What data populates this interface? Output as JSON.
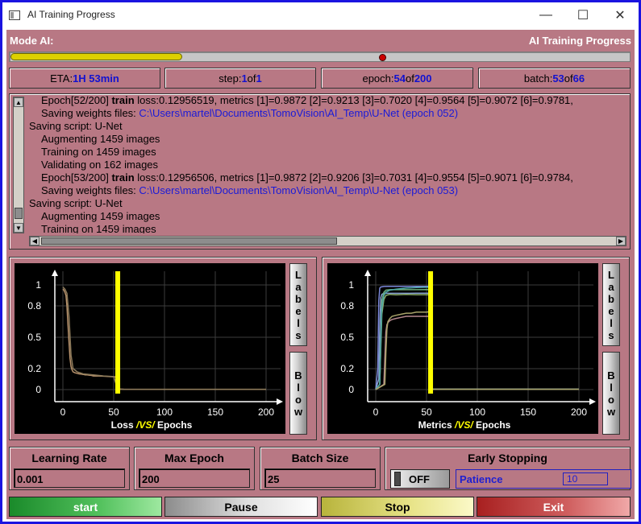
{
  "window": {
    "title": "AI Training Progress",
    "minimize": "—",
    "maximize": "☐",
    "close": "✕"
  },
  "header": {
    "left": "Mode AI:",
    "right": "AI Training Progress"
  },
  "progress": {
    "fraction": 0.278,
    "marker_fraction": 0.597
  },
  "stats": {
    "eta_label": "ETA:",
    "eta_value": "1H 53min",
    "step_label": "step:",
    "step_value": "1",
    "step_of": "of",
    "step_total": "1",
    "epoch_label": "epoch:",
    "epoch_value": "54",
    "epoch_of": "of",
    "epoch_total": "200",
    "batch_label": "batch:",
    "batch_value": "53",
    "batch_of": "of",
    "batch_total": "66"
  },
  "log": [
    {
      "indent": 2,
      "parts": [
        {
          "t": "Epoch[52/200]  "
        },
        {
          "t": "train",
          "b": true
        },
        {
          "t": " loss:0.12956519, metrics [1]=0.9872 [2]=0.9213 [3]=0.7020 [4]=0.9564 [5]=0.9072 [6]=0.9781,"
        }
      ]
    },
    {
      "indent": 2,
      "parts": [
        {
          "t": "Saving weights files: "
        },
        {
          "t": "C:\\Users\\martel\\Documents\\TomoVision\\AI_Temp\\U-Net (epoch 052)",
          "link": true
        }
      ]
    },
    {
      "indent": 0,
      "parts": [
        {
          "t": "Saving script: U-Net"
        }
      ]
    },
    {
      "indent": 1,
      "parts": [
        {
          "t": "Augmenting 1459 images"
        }
      ]
    },
    {
      "indent": 1,
      "parts": [
        {
          "t": "Training on 1459 images"
        }
      ]
    },
    {
      "indent": 1,
      "parts": [
        {
          "t": "Validating on 162 images"
        }
      ]
    },
    {
      "indent": 2,
      "parts": [
        {
          "t": "Epoch[53/200]  "
        },
        {
          "t": "train",
          "b": true
        },
        {
          "t": " loss:0.12956506, metrics [1]=0.9872 [2]=0.9206 [3]=0.7031 [4]=0.9554 [5]=0.9071 [6]=0.9784,"
        }
      ]
    },
    {
      "indent": 2,
      "parts": [
        {
          "t": "Saving weights files: "
        },
        {
          "t": "C:\\Users\\martel\\Documents\\TomoVision\\AI_Temp\\U-Net (epoch 053)",
          "link": true
        }
      ]
    },
    {
      "indent": 0,
      "parts": [
        {
          "t": "Saving script: U-Net"
        }
      ]
    },
    {
      "indent": 1,
      "parts": [
        {
          "t": "Augmenting 1459 images"
        }
      ]
    },
    {
      "indent": 1,
      "parts": [
        {
          "t": "Training on 1459 images"
        }
      ]
    }
  ],
  "labels_button": "Labels",
  "blow_button": "Blow",
  "chart_data": [
    {
      "type": "line",
      "title_parts": [
        "Loss",
        " /VS/ ",
        "Epochs"
      ],
      "xlim": [
        0,
        200
      ],
      "ylim": [
        0,
        1
      ],
      "xticks": [
        0,
        50,
        100,
        150,
        200
      ],
      "yticks": [
        0,
        0.2,
        0.5,
        0.8,
        1
      ],
      "ytick_labels": [
        "0",
        "0.2",
        "0.5",
        "0.8",
        "1"
      ],
      "marker_x": 54,
      "series": [
        {
          "color": "#b8926c",
          "x": [
            0,
            1,
            2,
            3,
            4,
            5,
            6,
            7,
            8,
            9,
            10,
            12,
            14,
            16,
            18,
            20,
            22,
            24,
            26,
            28,
            30,
            35,
            40,
            45,
            50,
            53,
            54,
            60,
            80,
            100,
            150,
            200
          ],
          "y": [
            0.96,
            0.95,
            0.93,
            0.9,
            0.8,
            0.62,
            0.45,
            0.3,
            0.22,
            0.19,
            0.17,
            0.16,
            0.155,
            0.15,
            0.148,
            0.145,
            0.14,
            0.14,
            0.138,
            0.135,
            0.13,
            0.13,
            0.128,
            0.125,
            0.122,
            0.12,
            0.005,
            0.003,
            0.002,
            0.002,
            0.002,
            0.002
          ]
        },
        {
          "color": "#8c7a5a",
          "x": [
            0,
            2,
            4,
            6,
            8,
            10,
            14,
            20,
            30,
            40,
            50,
            54,
            60,
            200
          ],
          "y": [
            0.98,
            0.96,
            0.92,
            0.7,
            0.33,
            0.2,
            0.17,
            0.15,
            0.14,
            0.13,
            0.125,
            0.004,
            0.003,
            0.003
          ]
        }
      ]
    },
    {
      "type": "line",
      "title_parts": [
        "Metrics",
        " /VS/ ",
        "Epochs"
      ],
      "xlim": [
        0,
        200
      ],
      "ylim": [
        0,
        1
      ],
      "xticks": [
        0,
        50,
        100,
        150,
        200
      ],
      "yticks": [
        0,
        0.2,
        0.5,
        0.8,
        1
      ],
      "ytick_labels": [
        "0",
        "0.2",
        "0.5",
        "0.8",
        "1"
      ],
      "marker_x": 54,
      "series": [
        {
          "color": "#7a86d8",
          "x": [
            0,
            2,
            3,
            4,
            5,
            8,
            12,
            20,
            30,
            40,
            50,
            53,
            54,
            60,
            200
          ],
          "y": [
            0,
            0.2,
            0.85,
            0.97,
            0.98,
            0.985,
            0.987,
            0.987,
            0.987,
            0.987,
            0.987,
            0.987,
            0.003,
            0.003,
            0.003
          ]
        },
        {
          "color": "#86a0d0",
          "x": [
            0,
            3,
            4,
            5,
            6,
            8,
            12,
            20,
            30,
            40,
            50,
            53,
            54,
            60,
            200
          ],
          "y": [
            0,
            0.1,
            0.6,
            0.88,
            0.91,
            0.92,
            0.92,
            0.92,
            0.92,
            0.921,
            0.921,
            0.92,
            0.003,
            0.003,
            0.003
          ]
        },
        {
          "color": "#8cae6a",
          "x": [
            0,
            4,
            5,
            6,
            8,
            10,
            14,
            20,
            30,
            40,
            50,
            53,
            54,
            60,
            200
          ],
          "y": [
            0,
            0.05,
            0.4,
            0.72,
            0.86,
            0.9,
            0.91,
            0.905,
            0.91,
            0.907,
            0.907,
            0.907,
            0.003,
            0.003,
            0.003
          ]
        },
        {
          "color": "#6cae7c",
          "x": [
            0,
            4,
            5,
            6,
            8,
            10,
            14,
            20,
            30,
            40,
            50,
            53,
            54,
            60,
            200
          ],
          "y": [
            0,
            0.05,
            0.5,
            0.85,
            0.93,
            0.95,
            0.955,
            0.956,
            0.955,
            0.955,
            0.956,
            0.955,
            0.003,
            0.003,
            0.003
          ]
        },
        {
          "color": "#4ea8a6",
          "x": [
            0,
            4,
            5,
            6,
            8,
            10,
            14,
            20,
            30,
            40,
            50,
            53,
            54,
            60,
            200
          ],
          "y": [
            0,
            0.05,
            0.45,
            0.78,
            0.9,
            0.93,
            0.95,
            0.96,
            0.97,
            0.975,
            0.978,
            0.978,
            0.003,
            0.003,
            0.003
          ]
        },
        {
          "color": "#b88a90",
          "x": [
            0,
            8,
            9,
            10,
            11,
            12,
            14,
            16,
            20,
            25,
            30,
            35,
            40,
            45,
            50,
            53,
            54,
            60,
            200
          ],
          "y": [
            0,
            0.05,
            0.3,
            0.55,
            0.62,
            0.64,
            0.66,
            0.67,
            0.68,
            0.69,
            0.7,
            0.7,
            0.7,
            0.7,
            0.7,
            0.7,
            0.003,
            0.003,
            0.003
          ]
        },
        {
          "color": "#a8a46a",
          "x": [
            0,
            9,
            10,
            11,
            12,
            14,
            16,
            20,
            25,
            30,
            35,
            40,
            45,
            50,
            53,
            54,
            60,
            200
          ],
          "y": [
            0,
            0.05,
            0.35,
            0.58,
            0.65,
            0.68,
            0.7,
            0.71,
            0.72,
            0.73,
            0.73,
            0.74,
            0.74,
            0.74,
            0.745,
            0.003,
            0.003,
            0.003
          ]
        }
      ]
    }
  ],
  "params": {
    "learning_rate_label": "Learning Rate",
    "learning_rate_value": "0.001",
    "max_epoch_label": "Max Epoch",
    "max_epoch_value": "200",
    "batch_size_label": "Batch Size",
    "batch_size_value": "25",
    "early_stopping_label": "Early Stopping",
    "early_stopping_state": "OFF",
    "patience_label": "Patience",
    "patience_value": "10"
  },
  "buttons": {
    "start": {
      "label": "start",
      "color": "#2e9a3a"
    },
    "pause": {
      "label": "Pause",
      "color": "#c0c0c0"
    },
    "stop": {
      "label": "Stop",
      "color": "#dad660"
    },
    "exit": {
      "label": "Exit",
      "color": "#c23838"
    }
  }
}
